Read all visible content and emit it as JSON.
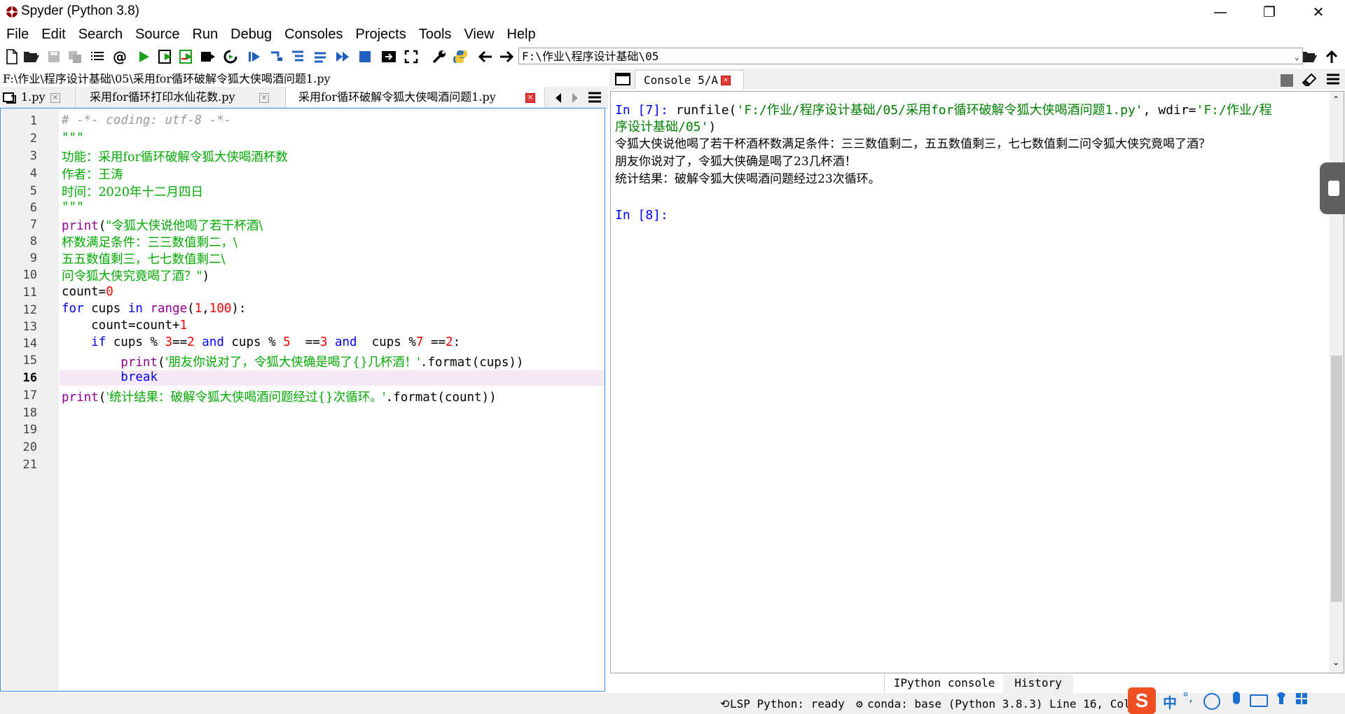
{
  "window": {
    "title": "Spyder (Python 3.8)",
    "minimize": "—",
    "maximize": "❐",
    "close": "✕"
  },
  "menu": [
    "File",
    "Edit",
    "Search",
    "Source",
    "Run",
    "Debug",
    "Consoles",
    "Projects",
    "Tools",
    "View",
    "Help"
  ],
  "toolbar": {
    "icons": [
      "new-file-icon",
      "open-file-icon",
      "save-icon",
      "save-all-icon",
      "list-icon",
      "at-icon",
      "run-icon",
      "run-cell-icon",
      "run-cell-advance-icon",
      "run-selection-icon",
      "rerun-icon",
      "debug-icon",
      "step-icon",
      "step-into-icon",
      "step-return-icon",
      "continue-icon",
      "stop-icon",
      "maximize-pane-icon",
      "fullscreen-icon",
      "preferences-icon",
      "python-path-icon"
    ],
    "working_dir": "F:\\作业\\程序设计基础\\05"
  },
  "editor": {
    "path": "F:\\作业\\程序设计基础\\05\\采用for循环破解令狐大侠喝酒问题1.py",
    "tabs": [
      {
        "label": "1.py"
      },
      {
        "label": "采用for循环打印水仙花数.py"
      },
      {
        "label": "采用for循环破解令狐大侠喝酒问题1.py"
      }
    ],
    "line_numbers": [
      "1",
      "2",
      "3",
      "4",
      "5",
      "6",
      "7",
      "8",
      "9",
      "10",
      "11",
      "12",
      "13",
      "14",
      "15",
      "16",
      "17",
      "18",
      "19",
      "20",
      "21"
    ],
    "current_line": "16",
    "code": {
      "l1": "# -*- coding: utf-8 -*-",
      "l2": "\"\"\"",
      "l3": "功能：采用for循环破解令狐大侠喝酒杯数",
      "l4": "作者：王涛",
      "l5": "时间：2020年十二月四日",
      "l6": "\"\"\"",
      "l7a": "print",
      "l7b": "(",
      "l7c": "\"令狐大侠说他喝了若干杯酒\\",
      "l8": "杯数满足条件：三三数值剩二，\\",
      "l9": "五五数值剩三，七七数值剩二\\",
      "l10a": "问令狐大侠究竟喝了酒？\"",
      "l10b": ")",
      "l11a": "count=",
      "l11b": "0",
      "l12a": "for",
      "l12b": " cups ",
      "l12c": "in",
      "l12d": " ",
      "l12e": "range",
      "l12f": "(",
      "l12g": "1",
      "l12h": ",",
      "l12i": "100",
      "l12j": "):",
      "l13a": "    count=count+",
      "l13b": "1",
      "l14a": "    ",
      "l14b": "if",
      "l14c": " cups % ",
      "l14d": "3",
      "l14e": "==",
      "l14f": "2",
      "l14g": " ",
      "l14h": "and",
      "l14i": " cups % ",
      "l14j": "5",
      "l14k": "  ==",
      "l14l": "3",
      "l14m": " ",
      "l14n": "and",
      "l14o": "  cups %",
      "l14p": "7",
      "l14q": " ==",
      "l14r": "2",
      "l14s": ":",
      "l15a": "        ",
      "l15b": "print",
      "l15c": "(",
      "l15d": "'朋友你说对了，令狐大侠确是喝了{}几杯酒！'",
      "l15e": ".format(cups))",
      "l16a": "        ",
      "l16b": "break",
      "l17a": "print",
      "l17b": "(",
      "l17c": "'统计结果：破解令狐大侠喝酒问题经过{}次循环。'",
      "l17d": ".format(count))"
    }
  },
  "console": {
    "tab_label": "Console 5/A",
    "prompt7": "In [7]: ",
    "run_a": "runfile(",
    "run_b": "'F:/作业/程序设计基础/05/采用for循环破解令狐大侠喝酒问题1.py'",
    "run_c": ", wdir=",
    "run_d": "'F:/作业/程",
    "run_e": "序设计基础/05'",
    "run_f": ")",
    "out1": "令狐大侠说他喝了若干杯酒杯数满足条件：三三数值剩二，五五数值剩三，七七数值剩二问令狐大侠究竟喝了酒？",
    "out2": "朋友你说对了，令狐大侠确是喝了23几杯酒！",
    "out3": "统计结果：破解令狐大侠喝酒问题经过23次循环。",
    "prompt8": "In [8]:",
    "bottom_tabs": [
      "IPython console",
      "History"
    ]
  },
  "statusbar": {
    "lsp": "LSP Python: ready",
    "conda": "conda: base (Python 3.8.3)",
    "position": "Line 16, Col"
  },
  "ime": {
    "lang": "中"
  },
  "colors": {
    "string": "#00aa00",
    "keyword": "#0000ff",
    "builtin": "#900090",
    "number": "#ff0000",
    "comment": "#999999",
    "current_line": "#f6e9f6",
    "close_red": "#e23b3b"
  }
}
